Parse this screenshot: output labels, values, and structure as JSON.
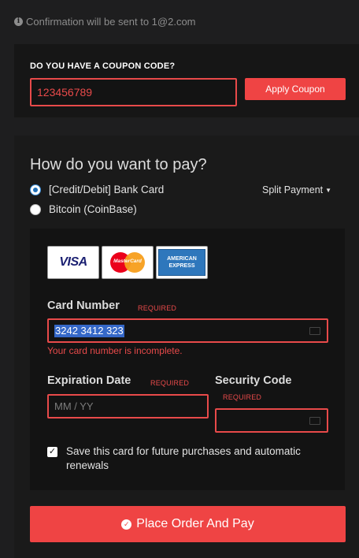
{
  "header": {
    "confirmation_text": "Confirmation will be sent to 1@2.com"
  },
  "coupon": {
    "title": "DO YOU HAVE A COUPON CODE?",
    "value": "123456789",
    "apply_label": "Apply Coupon"
  },
  "payment": {
    "title": "How do you want to pay?",
    "options": [
      {
        "label": "[Credit/Debit] Bank Card",
        "selected": true
      },
      {
        "label": "Bitcoin (CoinBase)",
        "selected": false
      }
    ],
    "split_label": "Split Payment"
  },
  "card": {
    "brands": {
      "visa": "VISA",
      "mastercard": "MasterCard",
      "amex_line1": "AMERICAN",
      "amex_line2": "EXPRESS"
    },
    "number_label": "Card Number",
    "required": "REQUIRED",
    "number_value": "3242 3412 323",
    "number_error": "Your card number is incomplete.",
    "expiration_label": "Expiration Date",
    "expiration_placeholder": "MM / YY",
    "security_label": "Security Code",
    "save_label": "Save this card for future purchases and automatic renewals",
    "save_checked": true
  },
  "order_button": {
    "label": "Place Order And Pay"
  },
  "colors": {
    "accent": "#ef4444",
    "background": "#1e1e1f",
    "panel": "#161616"
  }
}
